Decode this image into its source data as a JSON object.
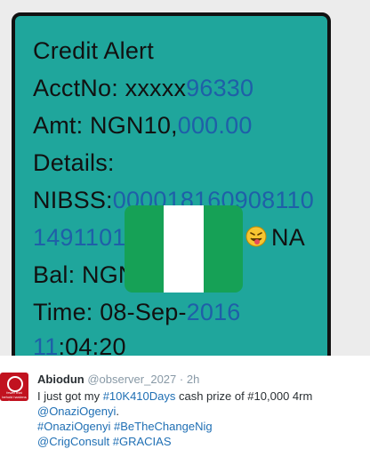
{
  "sms": {
    "title": "Credit Alert",
    "acct_label": "AcctNo: ",
    "acct_masked": "xxxxx",
    "acct_link": "96330",
    "amt_label": "Amt: NGN10,",
    "amt_link": "000.00",
    "details_label": "Details:",
    "nibss_label": "NIBSS:",
    "nibss_link1": "000018160908110",
    "nibss_link2": "1491101",
    "na_text": "NA",
    "bal_label": "Bal: NGN",
    "time_label": "Time: 08-Sep-",
    "time_link1": "2016",
    "time_link2": "11",
    "time_rest": ":04:20"
  },
  "overlay": {
    "flag_icon": "nigeria-flag",
    "emoji_icon": "tongue-out-emoji"
  },
  "tweet": {
    "avatar_text": "fewer that behold hardens the ego",
    "name": "Abiodun",
    "handle": "@observer_2027",
    "separator": "·",
    "time": "2h",
    "line1_prefix": "I just got my ",
    "line1_tag": "#10K410Days",
    "line1_suffix": " cash prize of #10,000 4rm",
    "line2_mention": "@OnaziOgenyi",
    "line2_suffix": ".",
    "line3_tag1": "#OnaziOgenyi",
    "line3_tag2": "#BeTheChangeNig",
    "line4_mention": "@CrigConsult",
    "line4_tag": "#GRACIAS"
  },
  "colors": {
    "card_bg": "#1fa69c",
    "link_blue": "#1f5fa8",
    "flag_green": "#16a156",
    "tweet_link": "#1f6fb4"
  }
}
